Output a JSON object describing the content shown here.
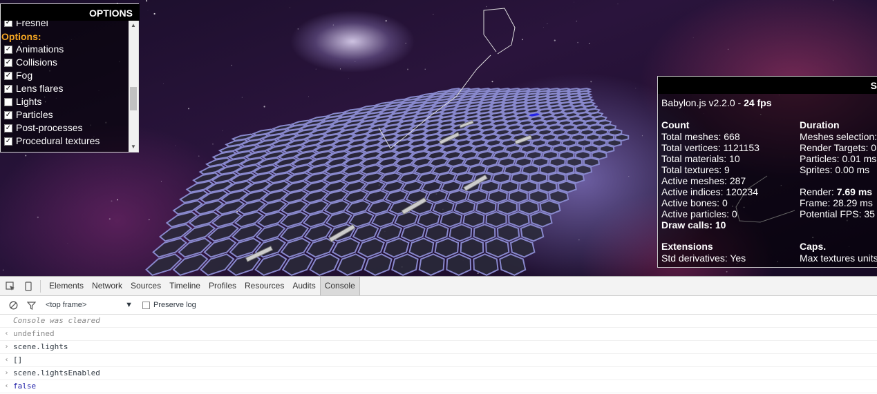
{
  "options_panel": {
    "title": "OPTIONS",
    "partial_item": "Fresnel",
    "section_label": "Options:",
    "items": [
      {
        "label": "Animations",
        "checked": true
      },
      {
        "label": "Collisions",
        "checked": true
      },
      {
        "label": "Fog",
        "checked": true
      },
      {
        "label": "Lens flares",
        "checked": true
      },
      {
        "label": "Lights",
        "checked": false
      },
      {
        "label": "Particles",
        "checked": true
      },
      {
        "label": "Post-processes",
        "checked": true
      },
      {
        "label": "Procedural textures",
        "checked": true
      }
    ]
  },
  "stats_panel": {
    "title_fragment": "S",
    "version": "Babylon.js v2.2.0 - ",
    "fps": "24 fps",
    "count": {
      "heading": "Count",
      "rows": [
        "Total meshes: 668",
        "Total vertices: 1121153",
        "Total materials: 10",
        "Total textures: 9",
        "Active meshes: 287",
        "Active indices: 120234",
        "Active bones: 0",
        "Active particles: 0"
      ],
      "draw_calls": "Draw calls: 10"
    },
    "duration": {
      "heading": "Duration",
      "rows": [
        "Meshes selection:",
        "Render Targets: 0",
        "Particles: 0.01 ms",
        "Sprites: 0.00 ms"
      ],
      "render_label": "Render: ",
      "render_value": "7.69 ms",
      "frame": "Frame: 28.29 ms",
      "potential_fps": "Potential FPS: 35"
    },
    "extensions": {
      "heading": "Extensions",
      "row": "Std derivatives: Yes"
    },
    "caps": {
      "heading": "Caps.",
      "row": "Max textures units"
    }
  },
  "devtools": {
    "tabs": [
      "Elements",
      "Network",
      "Sources",
      "Timeline",
      "Profiles",
      "Resources",
      "Audits",
      "Console"
    ],
    "active_tab": "Console",
    "frame_select": "<top frame>",
    "preserve_log": "Preserve log",
    "console": [
      {
        "kind": "cleared",
        "text": "Console was cleared"
      },
      {
        "kind": "undef",
        "text": "undefined"
      },
      {
        "kind": "input",
        "text": "scene.lights"
      },
      {
        "kind": "output",
        "text": "[]"
      },
      {
        "kind": "input",
        "text": "scene.lightsEnabled"
      },
      {
        "kind": "result-false",
        "text": "false"
      }
    ]
  },
  "colors": {
    "accent_orange": "#f5a623",
    "hex_fill": "#2a2a3a",
    "hex_edge": "#8888cc",
    "selected_hex": "#2222ee",
    "false_value": "#1a1aa6"
  }
}
